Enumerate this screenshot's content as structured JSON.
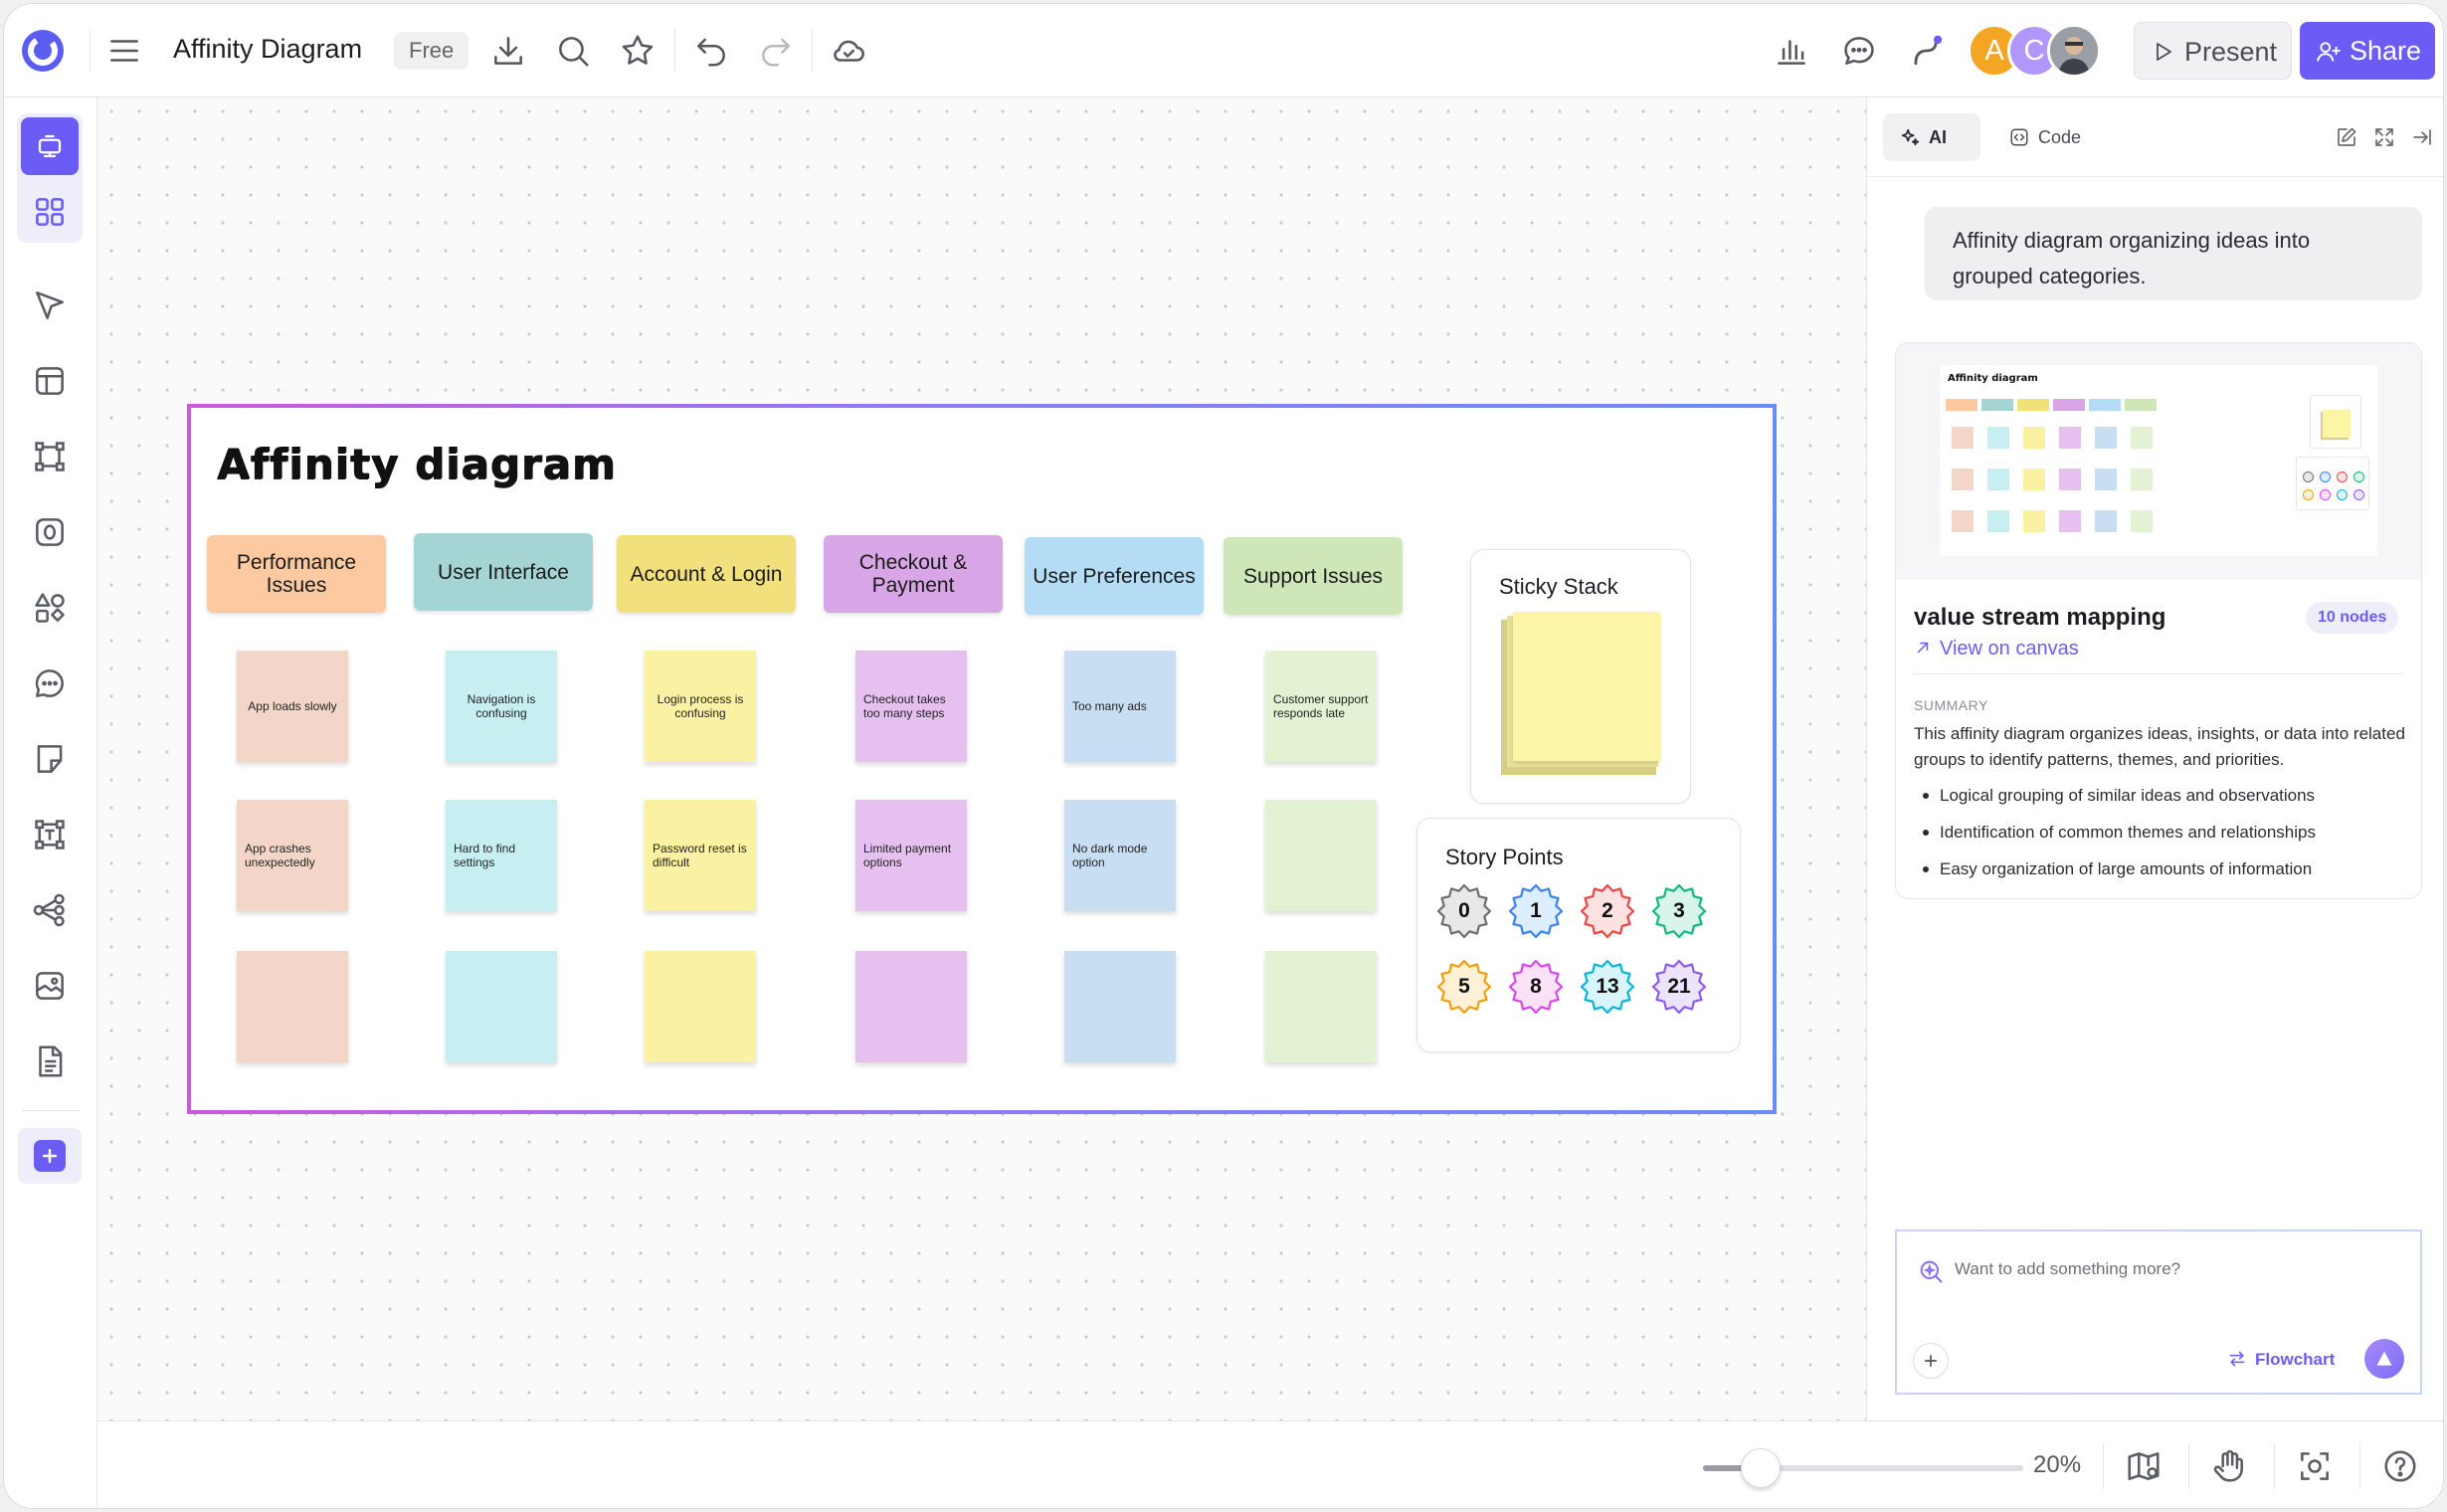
{
  "header": {
    "doc_title": "Affinity Diagram",
    "plan_badge": "Free",
    "avatars": [
      {
        "initial": "A",
        "color": "#f5a524"
      },
      {
        "initial": "C",
        "color": "#b197fc"
      },
      {
        "initial": "",
        "color": "#8a8d94"
      }
    ],
    "present_label": "Present",
    "share_label": "Share"
  },
  "canvas": {
    "frame_title": "Affinity diagram",
    "categories": [
      {
        "label": "Performance\nIssues",
        "color": "#fdc9a0",
        "note_color": "#f3d6c8",
        "notes": [
          "App loads slowly",
          "App crashes unexpectedly",
          ""
        ]
      },
      {
        "label": "User Interface",
        "color": "#a5d4d4",
        "note_color": "#c7eef0",
        "notes": [
          "Navigation is confusing",
          "Hard to find settings",
          ""
        ]
      },
      {
        "label": "Account & Login",
        "color": "#f2e07c",
        "note_color": "#fbf1a2",
        "notes": [
          "Login process is confusing",
          "Password reset is difficult",
          ""
        ]
      },
      {
        "label": "Checkout &\nPayment",
        "color": "#d8a6e6",
        "note_color": "#e6c1ef",
        "notes": [
          "Checkout takes too many steps",
          "Limited payment options",
          ""
        ]
      },
      {
        "label": "User Preferences",
        "color": "#b4dcf5",
        "note_color": "#c8def3",
        "notes": [
          "Too many ads",
          "No dark mode option",
          ""
        ]
      },
      {
        "label": "Support Issues",
        "color": "#cfe6b9",
        "note_color": "#e2f2d3",
        "notes": [
          "Customer support responds late",
          "",
          ""
        ]
      }
    ],
    "sticky_stack": {
      "title": "Sticky Stack"
    },
    "story_points": {
      "title": "Story Points",
      "items": [
        {
          "value": "0",
          "fill": "#e8e8e8",
          "stroke": "#6e6e6e"
        },
        {
          "value": "1",
          "fill": "#dceeff",
          "stroke": "#3b82f6"
        },
        {
          "value": "2",
          "fill": "#fde2e2",
          "stroke": "#ef4444"
        },
        {
          "value": "3",
          "fill": "#d9f5ea",
          "stroke": "#10b981"
        },
        {
          "value": "5",
          "fill": "#fff1d6",
          "stroke": "#f59e0b"
        },
        {
          "value": "8",
          "fill": "#fbe2f6",
          "stroke": "#d946ef"
        },
        {
          "value": "13",
          "fill": "#d9f4fb",
          "stroke": "#06b6d4"
        },
        {
          "value": "21",
          "fill": "#ece4fd",
          "stroke": "#8b5cf6"
        }
      ]
    }
  },
  "bottom": {
    "zoom_label": "20%",
    "zoom_fraction": 0.18
  },
  "panel": {
    "tab_ai": "AI",
    "tab_code": "Code",
    "prompt": "Affinity diagram organizing ideas into grouped categories.",
    "result": {
      "title": "value stream mapping",
      "nodes_badge": "10 nodes",
      "view_link": "View on canvas",
      "summary_label": "SUMMARY",
      "summary": "This affinity diagram organizes ideas, insights, or data into related groups to identify patterns, themes, and priorities.",
      "bullets": [
        "Logical grouping of similar ideas and observations",
        "Identification of common themes and relationships",
        "Easy organization of large amounts of information"
      ],
      "thumb_title": "Affinity diagram"
    },
    "chat": {
      "placeholder": "Want to add something more?",
      "mode_label": "Flowchart"
    }
  }
}
